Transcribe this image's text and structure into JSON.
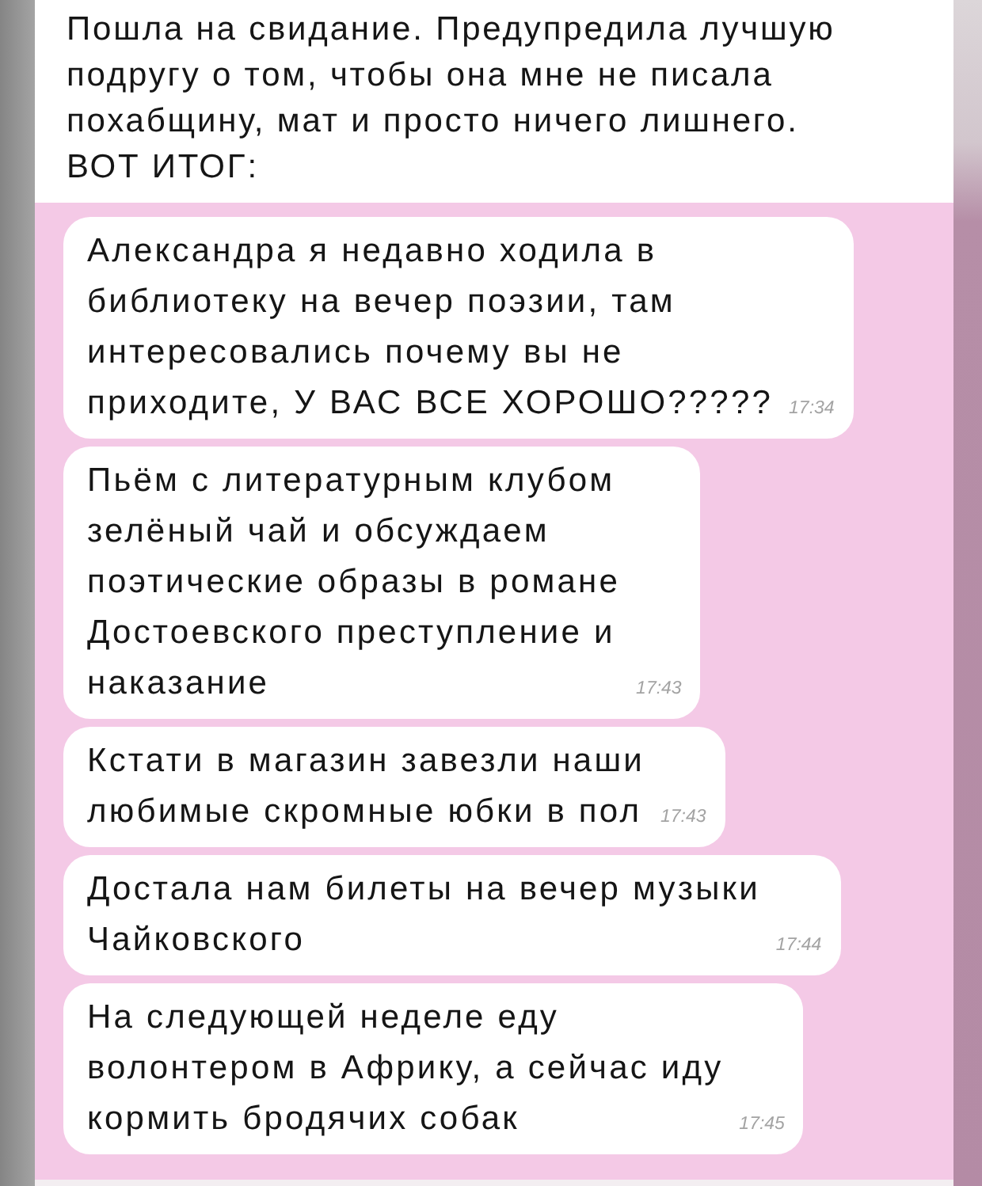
{
  "caption": "Пошла на свидание. Предупредила лучшую\nподругу о том, чтобы она мне не писала\nпохабщину, мат и просто ничего лишнего.\nВОТ ИТОГ:",
  "messages": [
    {
      "text": "Александра я недавно ходила в\nбиблиотеку на вечер поэзии, там\nинтересовались почему вы не\nприходите, У ВАС ВСЕ ХОРОШО?????",
      "time": "17:34"
    },
    {
      "text": "Пьём с литературным клубом\nзелёный чай и обсуждаем\nпоэтические образы в романе\nДостоевского преступление и\nнаказание",
      "time": "17:43"
    },
    {
      "text": "Кстати в магазин завезли наши\nлюбимые скромные юбки в пол",
      "time": "17:43"
    },
    {
      "text": "Достала нам билеты на вечер музыки\nЧайковского",
      "time": "17:44"
    },
    {
      "text": "На следующей неделе еду\nволонтером в Африку, а сейчас иду\nкормить бродячих собак",
      "time": "17:45"
    }
  ]
}
